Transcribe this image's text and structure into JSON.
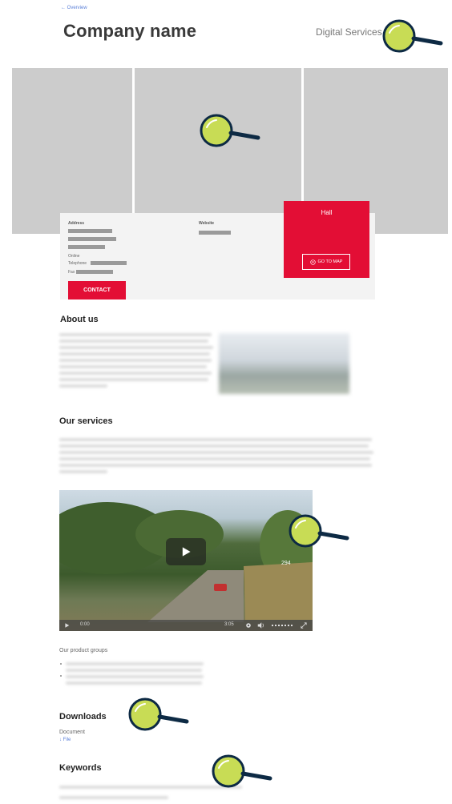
{
  "header": {
    "back_label": "← Overview",
    "company_name": "Company name",
    "category": "Digital Services"
  },
  "contact_card": {
    "address_label": "Address",
    "website_label": "Website",
    "online_label": "Online",
    "telephone_label": "Telephone",
    "fax_label": "Fax",
    "contact_button": "CONTACT"
  },
  "hall_box": {
    "hall_label": "Hall",
    "map_button": "GO TO MAP"
  },
  "about": {
    "title": "About us"
  },
  "services": {
    "title": "Our services"
  },
  "video": {
    "current_time": "0:00",
    "duration": "3:05",
    "sign_number": "294"
  },
  "product_groups": {
    "title": "Our product groups"
  },
  "downloads": {
    "title": "Downloads",
    "document_label": "Document",
    "file_link": "File"
  },
  "keywords": {
    "title": "Keywords"
  },
  "colors": {
    "accent_red": "#e30e35",
    "placeholder_gray": "#cccccc",
    "magnifier_fill": "#c8dc55",
    "magnifier_stroke": "#0d2a44"
  },
  "icons": [
    "magnifier-icon",
    "location-pin-icon",
    "play-icon",
    "settings-icon",
    "volume-icon",
    "fullscreen-icon",
    "download-arrow-icon"
  ]
}
